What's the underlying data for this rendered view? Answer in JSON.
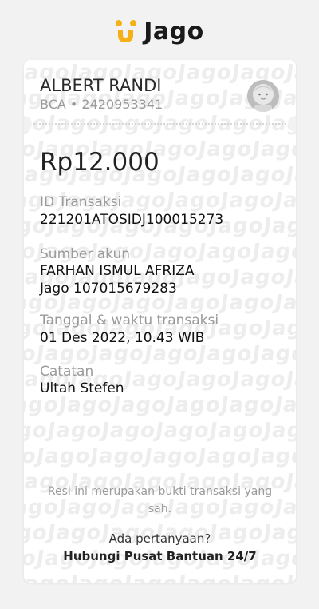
{
  "brand": {
    "name": "Jago",
    "accent": "#f5b015"
  },
  "recipient": {
    "name": "ALBERT RANDI",
    "bank": "BCA • 2420953341"
  },
  "amount": "Rp12.000",
  "fields": [
    {
      "label": "ID Transaksi",
      "values": [
        "221201ATOSIDJ100015273"
      ]
    },
    {
      "label": "Sumber akun",
      "values": [
        "FARHAN ISMUL AFRIZA",
        "Jago 107015679283"
      ]
    },
    {
      "label": "Tanggal & waktu transaksi",
      "values": [
        "01 Des 2022, 10.43 WIB"
      ]
    },
    {
      "label": "Catatan",
      "values": [
        "Ultah Stefen"
      ]
    }
  ],
  "footer": {
    "receipt_note": "Resi ini merupakan bukti transaksi yang sah.",
    "question": "Ada pertanyaan?",
    "help_link": "Hubungi Pusat Bantuan 24/7"
  },
  "watermark_text": "JagoJagoJagoJagoJagoJagoJago"
}
